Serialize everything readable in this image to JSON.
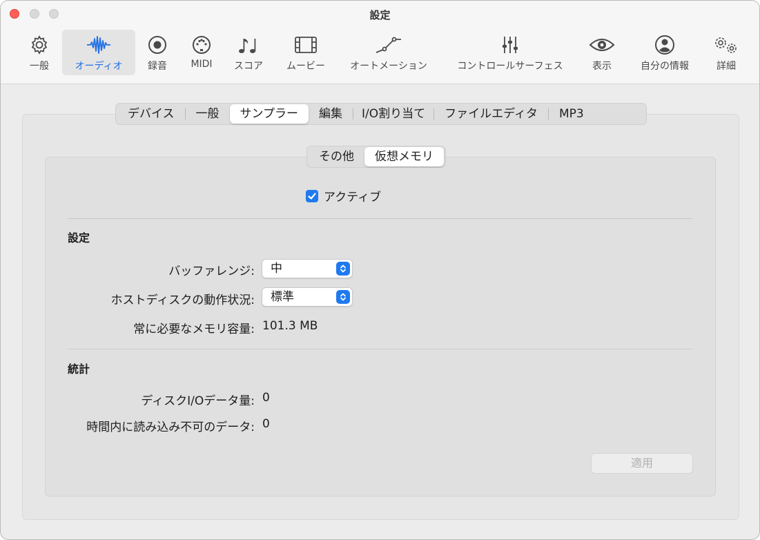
{
  "window": {
    "title": "設定"
  },
  "toolbar": {
    "items": [
      {
        "label": "一般",
        "icon": "gear-icon"
      },
      {
        "label": "オーディオ",
        "icon": "waveform-icon",
        "active": true
      },
      {
        "label": "録音",
        "icon": "record-icon"
      },
      {
        "label": "MIDI",
        "icon": "midi-port-icon"
      },
      {
        "label": "スコア",
        "icon": "music-notes-icon"
      },
      {
        "label": "ムービー",
        "icon": "film-icon"
      },
      {
        "label": "オートメーション",
        "icon": "automation-curve-icon"
      },
      {
        "label": "コントロールサーフェス",
        "icon": "faders-icon"
      },
      {
        "label": "表示",
        "icon": "eye-icon"
      },
      {
        "label": "自分の情報",
        "icon": "person-icon"
      },
      {
        "label": "詳細",
        "icon": "gears-icon"
      }
    ]
  },
  "tabs": [
    {
      "label": "デバイス"
    },
    {
      "label": "一般"
    },
    {
      "label": "サンプラー",
      "selected": true
    },
    {
      "label": "編集"
    },
    {
      "label": "I/O割り当て"
    },
    {
      "label": "ファイルエディタ"
    },
    {
      "label": "MP3"
    }
  ],
  "subtabs": [
    {
      "label": "その他"
    },
    {
      "label": "仮想メモリ",
      "selected": true
    }
  ],
  "active_checkbox": {
    "label": "アクティブ",
    "checked": true
  },
  "settings": {
    "title": "設定",
    "buffer_range": {
      "label": "バッファレンジ:",
      "value": "中"
    },
    "host_disk": {
      "label": "ホストディスクの動作状況:",
      "value": "標準"
    },
    "memory": {
      "label": "常に必要なメモリ容量:",
      "value": "101.3 MB"
    }
  },
  "stats": {
    "title": "統計",
    "disk_io": {
      "label": "ディスクI/Oデータ量:",
      "value": "0"
    },
    "unreadable": {
      "label": "時間内に読み込み不可のデータ:",
      "value": "0"
    }
  },
  "apply_label": "適用",
  "colors": {
    "accent": "#1f7aef",
    "close": "#ff5f57"
  }
}
